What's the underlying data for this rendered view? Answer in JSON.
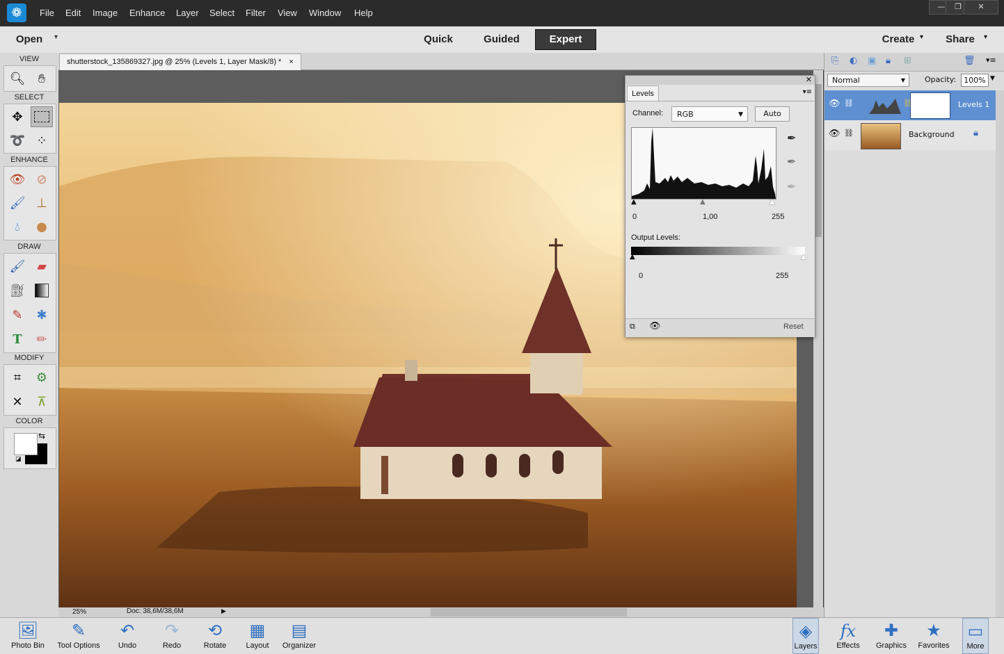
{
  "menu": [
    "File",
    "Edit",
    "Image",
    "Enhance",
    "Layer",
    "Select",
    "Filter",
    "View",
    "Window",
    "Help"
  ],
  "window_controls": {
    "minimize": "—",
    "restore": "❐",
    "close": "✕"
  },
  "modebar": {
    "open": "Open",
    "quick": "Quick",
    "guided": "Guided",
    "expert": "Expert",
    "create": "Create",
    "share": "Share"
  },
  "toolbox": {
    "view": "VIEW",
    "select": "SELECT",
    "enhance": "ENHANCE",
    "draw": "DRAW",
    "modify": "MODIFY",
    "color": "COLOR"
  },
  "document": {
    "tab": "shutterstock_135869327.jpg @ 25% (Levels 1, Layer Mask/8) *",
    "close": "×",
    "zoom": "25%",
    "doc_info": "Doc: 38,6M/38,6M"
  },
  "levels": {
    "tab": "Levels",
    "channel_label": "Channel:",
    "channel": "RGB",
    "auto": "Auto",
    "input_black": "0",
    "input_mid": "1,00",
    "input_white": "255",
    "output_label": "Output Levels:",
    "output_black": "0",
    "output_white": "255",
    "reset": "Reset"
  },
  "layers_panel": {
    "blend_mode": "Normal",
    "opacity_label": "Opacity:",
    "opacity": "100%",
    "layers": [
      {
        "name": "Levels 1",
        "selected": true
      },
      {
        "name": "Background",
        "selected": false
      }
    ]
  },
  "bottombar": {
    "photo_bin": "Photo Bin",
    "tool_options": "Tool Options",
    "undo": "Undo",
    "redo": "Redo",
    "rotate": "Rotate",
    "layout": "Layout",
    "organizer": "Organizer",
    "layers": "Layers",
    "effects": "Effects",
    "graphics": "Graphics",
    "favorites": "Favorites",
    "more": "More"
  },
  "colors": {
    "accent": "#5d8fd1",
    "expert_bg": "#3a3a3a"
  }
}
